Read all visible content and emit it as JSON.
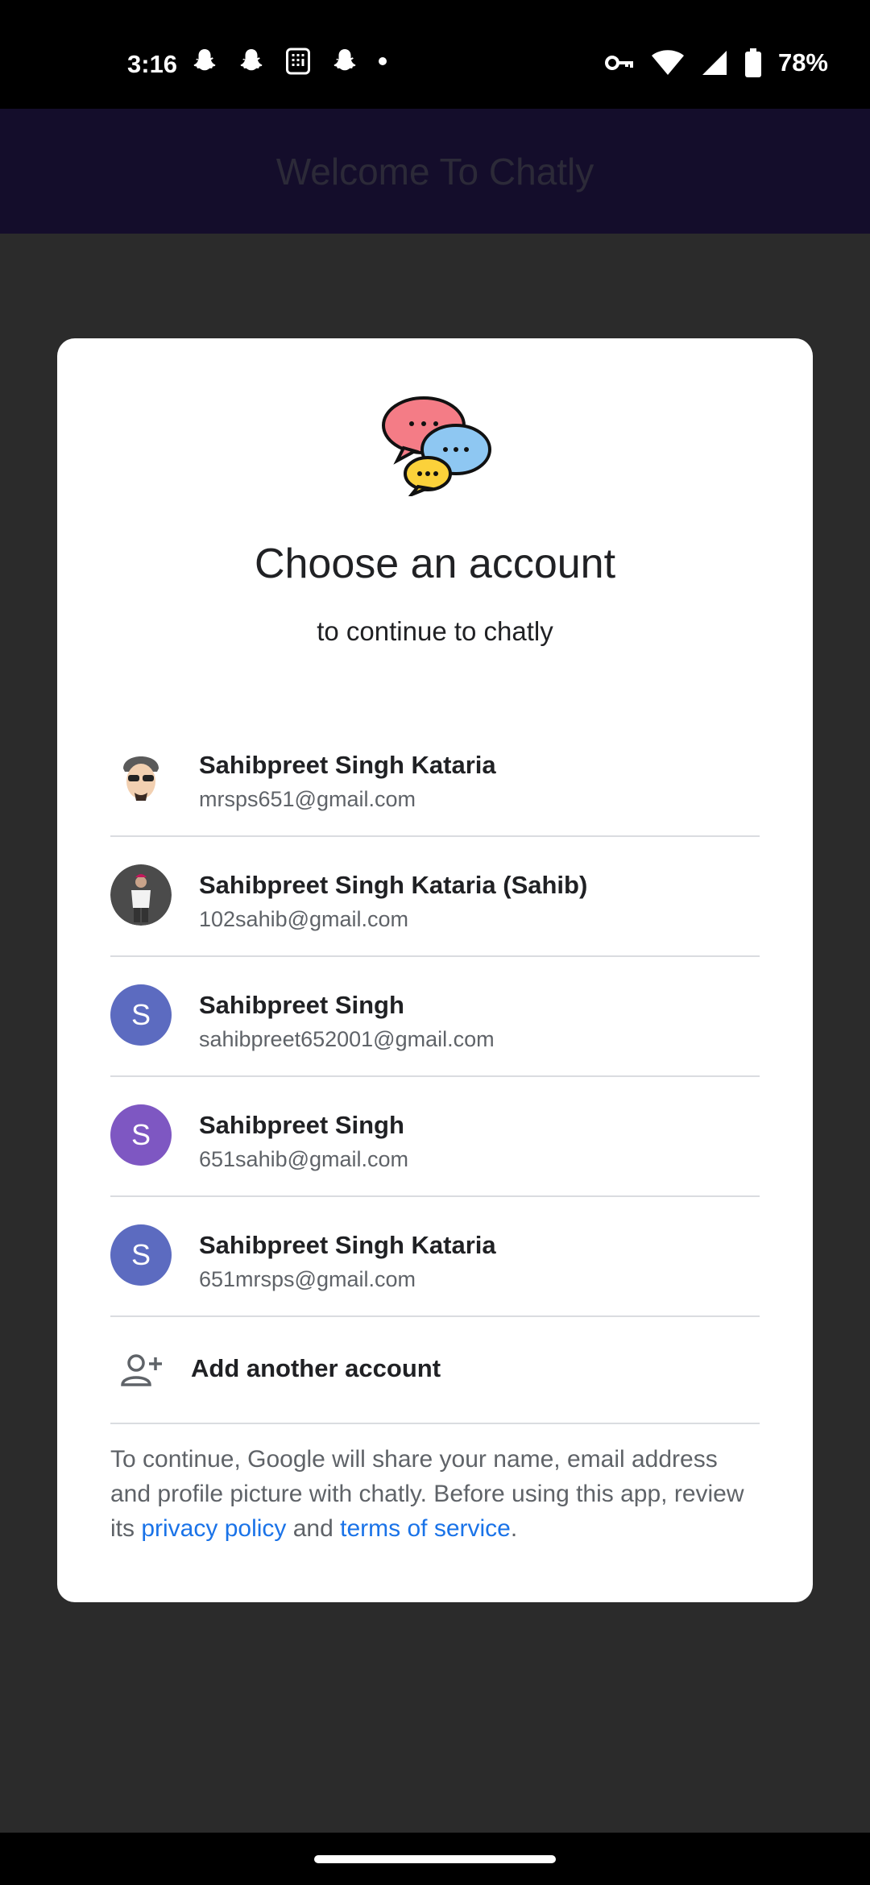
{
  "status": {
    "time": "3:16",
    "battery": "78%",
    "icons": [
      "snapchat-icon",
      "snapchat-icon",
      "calculator-icon",
      "snapchat-icon",
      "dot-icon",
      "vpn-key-icon",
      "wifi-icon",
      "signal-icon",
      "battery-icon"
    ]
  },
  "app": {
    "title": "Welcome To Chatly"
  },
  "dialog": {
    "title": "Choose an account",
    "subtitle": "to continue to chatly",
    "accounts": [
      {
        "name": "Sahibpreet Singh Kataria",
        "email": "mrsps651@gmail.com",
        "avatar": "cartoon",
        "initial": ""
      },
      {
        "name": "Sahibpreet Singh Kataria (Sahib)",
        "email": "102sahib@gmail.com",
        "avatar": "photo",
        "initial": ""
      },
      {
        "name": "Sahibpreet Singh",
        "email": "sahibpreet652001@gmail.com",
        "avatar": "letter",
        "initial": "S",
        "color": "#5c6bc0"
      },
      {
        "name": "Sahibpreet Singh",
        "email": "651sahib@gmail.com",
        "avatar": "letter",
        "initial": "S",
        "color": "#7e57c2"
      },
      {
        "name": "Sahibpreet Singh Kataria",
        "email": "651mrsps@gmail.com",
        "avatar": "letter",
        "initial": "S",
        "color": "#5c6bc0"
      }
    ],
    "add_account": "Add another account",
    "footer": {
      "prefix": "To continue, Google will share your name, email address and profile picture with chatly. Before using this app, review its ",
      "privacy": "privacy policy",
      "and": " and ",
      "terms": "terms of service",
      "suffix": "."
    }
  }
}
